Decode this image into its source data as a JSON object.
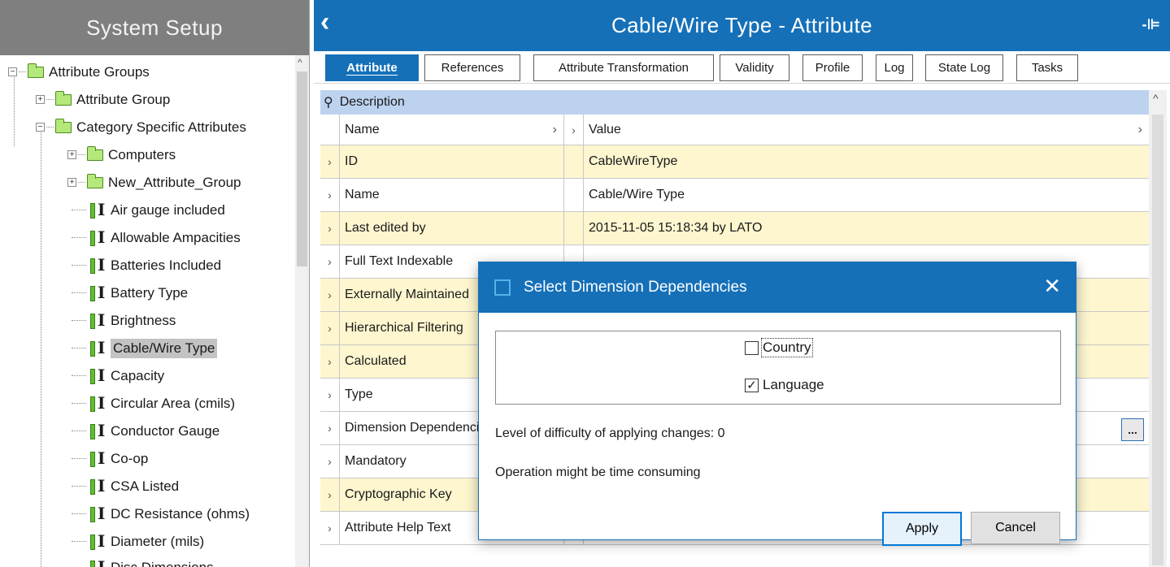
{
  "left_panel": {
    "title": "System Setup",
    "tree": [
      {
        "label": "Attribute Groups",
        "type": "folder",
        "expander": "−"
      },
      {
        "label": "Attribute Group",
        "type": "folder",
        "expander": "+"
      },
      {
        "label": "Category Specific Attributes",
        "type": "folder",
        "expander": "−"
      },
      {
        "label": "Computers",
        "type": "folder",
        "expander": "+"
      },
      {
        "label": "New_Attribute_Group",
        "type": "folder",
        "expander": "+"
      },
      {
        "label": "Air gauge included",
        "type": "attribute"
      },
      {
        "label": "Allowable Ampacities",
        "type": "attribute"
      },
      {
        "label": "Batteries Included",
        "type": "attribute"
      },
      {
        "label": "Battery Type",
        "type": "attribute"
      },
      {
        "label": "Brightness",
        "type": "attribute"
      },
      {
        "label": "Cable/Wire Type",
        "type": "attribute",
        "selected": true
      },
      {
        "label": "Capacity",
        "type": "attribute"
      },
      {
        "label": "Circular Area (cmils)",
        "type": "attribute"
      },
      {
        "label": "Conductor Gauge",
        "type": "attribute"
      },
      {
        "label": "Co-op",
        "type": "attribute"
      },
      {
        "label": "CSA Listed",
        "type": "attribute"
      },
      {
        "label": "DC Resistance (ohms)",
        "type": "attribute"
      },
      {
        "label": "Diameter (mils)",
        "type": "attribute"
      },
      {
        "label": "Disc Dimensions",
        "type": "attribute"
      }
    ]
  },
  "header": {
    "title": "Cable/Wire Type - Attribute",
    "back_icon": "‹",
    "pin_icon": "-⊫"
  },
  "tabs": [
    "Attribute",
    "References",
    "Attribute Transformation",
    "Validity",
    "Profile",
    "Log",
    "State Log",
    "Tasks"
  ],
  "grid": {
    "section": "Description",
    "col_name": "Name",
    "col_value": "Value",
    "rows": [
      {
        "name": "ID",
        "value": "CableWireType"
      },
      {
        "name": "Name",
        "value": "Cable/Wire Type"
      },
      {
        "name": "Last edited by",
        "value": "2015-11-05 15:18:34 by LATO"
      },
      {
        "name": "Full Text Indexable",
        "value": ""
      },
      {
        "name": "Externally Maintained",
        "value": ""
      },
      {
        "name": "Hierarchical Filtering",
        "value": ""
      },
      {
        "name": "Calculated",
        "value": ""
      },
      {
        "name": "Type",
        "value": ""
      },
      {
        "name": "Dimension Dependencies",
        "value": ""
      },
      {
        "name": "Mandatory",
        "value": ""
      },
      {
        "name": "Cryptographic Key",
        "value": ""
      },
      {
        "name": "Attribute Help Text",
        "value": ""
      }
    ],
    "ellipsis": "..."
  },
  "dialog": {
    "title": "Select Dimension Dependencies",
    "close": "✕",
    "options": [
      {
        "label": "Country",
        "checked": false
      },
      {
        "label": "Language",
        "checked": true
      }
    ],
    "difficulty": "Level of difficulty of applying changes: 0",
    "warning": "Operation might be time consuming",
    "apply": "Apply",
    "cancel": "Cancel"
  }
}
